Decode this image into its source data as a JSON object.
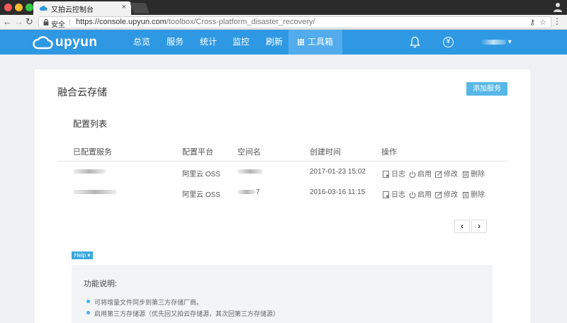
{
  "browser": {
    "tab_title": "又拍云控制台",
    "tab_close": "×",
    "secure_label": "安全",
    "url_host": "https://console.upyun.com",
    "url_path": "/toolbox/Cross-platform_disaster_recovery/"
  },
  "header": {
    "logo_text": "upyun",
    "nav": [
      "总览",
      "服务",
      "统计",
      "监控",
      "刷新"
    ],
    "active_nav": "工具箱",
    "currency_symbol": "¥",
    "user_caret": "▾"
  },
  "page": {
    "title": "融合云存储",
    "add_button": "添加服务",
    "section_title": "配置列表"
  },
  "table": {
    "headers": [
      "已配置服务",
      "配置平台",
      "空间名",
      "创建时间",
      "操作"
    ],
    "rows": [
      {
        "platform": "阿里云 OSS",
        "space_suffix": "",
        "created": "2017-01-23 15:02"
      },
      {
        "platform": "阿里云 OSS",
        "space_suffix": "7",
        "created": "2016-03-16 11:15"
      }
    ],
    "actions": [
      "日志",
      "启用",
      "修改",
      "删除"
    ]
  },
  "pagination": {
    "prev": "‹",
    "next": "›"
  },
  "help": {
    "tag": "Help ▾",
    "title": "功能说明:",
    "items": [
      "可将增量文件同步到第三方存储厂商。",
      "启用第三方存储源（优先回又拍云存储源，其次回第三方存储源）"
    ]
  },
  "colors": {
    "header_bg": "#2f98e2",
    "active_nav_bg": "#52acec",
    "add_button_bg": "#58b7e6",
    "help_tag_bg": "#3ca9e0"
  }
}
